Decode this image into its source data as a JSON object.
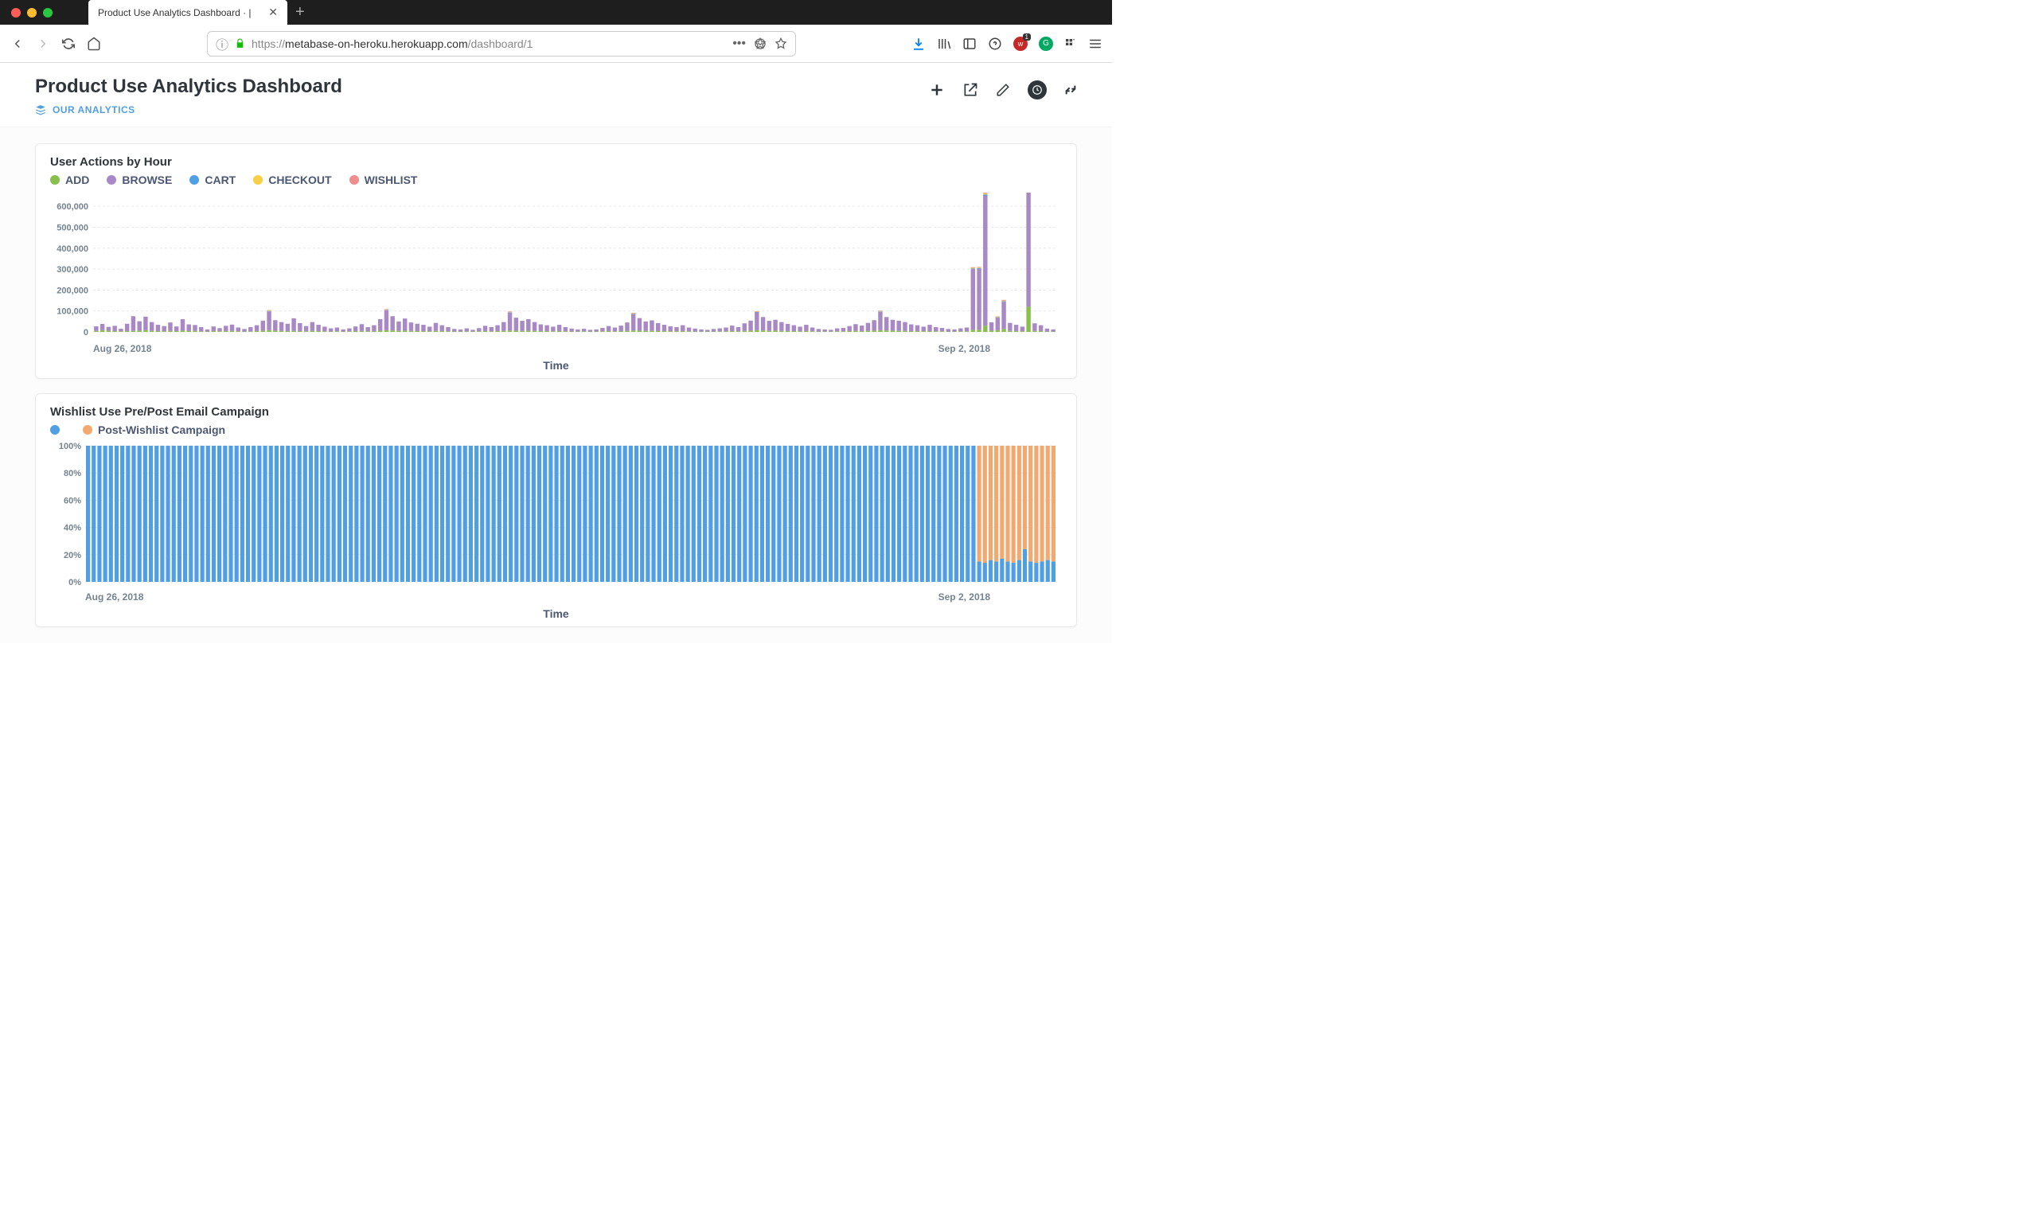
{
  "browser": {
    "tab_title": "Product Use Analytics Dashboard · |",
    "url_prefix": "https://",
    "url_host": "metabase-on-heroku.herokuapp.com",
    "url_path": "/dashboard/1"
  },
  "page": {
    "title": "Product Use Analytics Dashboard",
    "breadcrumb": "OUR ANALYTICS"
  },
  "chart1": {
    "title": "User Actions by Hour",
    "legend": [
      {
        "label": "ADD",
        "color": "#88BF4D"
      },
      {
        "label": "BROWSE",
        "color": "#A989C5"
      },
      {
        "label": "CART",
        "color": "#509EE3"
      },
      {
        "label": "CHECKOUT",
        "color": "#F9CF48"
      },
      {
        "label": "WISHLIST",
        "color": "#EF8C8C"
      }
    ],
    "ylabel_ticks": [
      "600,000",
      "500,000",
      "400,000",
      "300,000",
      "200,000",
      "100,000",
      "0"
    ],
    "xlabel": "Time",
    "xticks": [
      "Aug 26, 2018",
      "Sep 2, 2018"
    ]
  },
  "chart2": {
    "title": "Wishlist Use Pre/Post Email Campaign",
    "legend": [
      {
        "label": "",
        "color": "#509EE3"
      },
      {
        "label": "Post-Wishlist Campaign",
        "color": "#F2A86F"
      }
    ],
    "ylabel_ticks": [
      "100%",
      "80%",
      "60%",
      "40%",
      "20%",
      "0%"
    ],
    "xlabel": "Time",
    "xticks": [
      "Aug 26, 2018",
      "Sep 2, 2018"
    ]
  },
  "chart_data": [
    {
      "type": "bar",
      "title": "User Actions by Hour",
      "xlabel": "Time",
      "ylabel": "",
      "ylim": [
        0,
        650000
      ],
      "yticks": [
        0,
        100000,
        200000,
        300000,
        400000,
        500000,
        600000
      ],
      "categories_note": "hourly buckets from Aug 26 2018 through Sep 2 2018 (~170 bars)",
      "series": [
        {
          "name": "ADD",
          "color": "#88BF4D",
          "typical_range": [
            0,
            120000
          ]
        },
        {
          "name": "BROWSE",
          "color": "#A989C5",
          "typical_range": [
            5000,
            90000
          ],
          "spikes": [
            290000,
            290000,
            620000,
            130000,
            560000
          ]
        },
        {
          "name": "CART",
          "color": "#509EE3",
          "typical_range": [
            0,
            8000
          ]
        },
        {
          "name": "CHECKOUT",
          "color": "#F9CF48",
          "typical_range": [
            0,
            8000
          ]
        },
        {
          "name": "WISHLIST",
          "color": "#EF8C8C",
          "typical_range": [
            0,
            8000
          ]
        }
      ],
      "values": [
        [
          5,
          22,
          0,
          0,
          0
        ],
        [
          8,
          30,
          0,
          0,
          0
        ],
        [
          6,
          18,
          0,
          0,
          0
        ],
        [
          4,
          25,
          0,
          0,
          0
        ],
        [
          3,
          12,
          0,
          0,
          0
        ],
        [
          4,
          35,
          0,
          0,
          0
        ],
        [
          5,
          70,
          1,
          1,
          1
        ],
        [
          6,
          45,
          1,
          1,
          1
        ],
        [
          8,
          65,
          1,
          1,
          1
        ],
        [
          5,
          42,
          1,
          1,
          1
        ],
        [
          4,
          30,
          1,
          1,
          1
        ],
        [
          3,
          25,
          0,
          0,
          0
        ],
        [
          5,
          40,
          1,
          1,
          1
        ],
        [
          4,
          22,
          0,
          0,
          0
        ],
        [
          6,
          55,
          1,
          1,
          1
        ],
        [
          4,
          32,
          1,
          1,
          1
        ],
        [
          5,
          28,
          0,
          0,
          0
        ],
        [
          3,
          20,
          0,
          0,
          0
        ],
        [
          2,
          10,
          0,
          0,
          0
        ],
        [
          4,
          22,
          0,
          0,
          0
        ],
        [
          3,
          15,
          0,
          0,
          0
        ],
        [
          4,
          25,
          0,
          0,
          0
        ],
        [
          5,
          30,
          1,
          1,
          1
        ],
        [
          3,
          18,
          0,
          0,
          0
        ],
        [
          2,
          12,
          0,
          0,
          0
        ],
        [
          3,
          20,
          0,
          0,
          0
        ],
        [
          4,
          28,
          0,
          0,
          0
        ],
        [
          6,
          48,
          1,
          1,
          1
        ],
        [
          8,
          90,
          2,
          2,
          2
        ],
        [
          6,
          50,
          1,
          1,
          1
        ],
        [
          5,
          42,
          1,
          1,
          1
        ],
        [
          4,
          35,
          1,
          1,
          1
        ],
        [
          5,
          60,
          1,
          1,
          1
        ],
        [
          4,
          38,
          1,
          1,
          1
        ],
        [
          3,
          25,
          0,
          0,
          0
        ],
        [
          5,
          42,
          1,
          1,
          1
        ],
        [
          4,
          30,
          0,
          0,
          0
        ],
        [
          3,
          22,
          0,
          0,
          0
        ],
        [
          2,
          15,
          0,
          0,
          0
        ],
        [
          3,
          18,
          0,
          0,
          0
        ],
        [
          2,
          10,
          0,
          0,
          0
        ],
        [
          3,
          14,
          0,
          0,
          0
        ],
        [
          4,
          22,
          0,
          0,
          0
        ],
        [
          5,
          32,
          1,
          1,
          1
        ],
        [
          3,
          20,
          0,
          0,
          0
        ],
        [
          4,
          28,
          0,
          0,
          0
        ],
        [
          6,
          55,
          1,
          1,
          1
        ],
        [
          8,
          95,
          2,
          2,
          2
        ],
        [
          7,
          68,
          1,
          1,
          1
        ],
        [
          5,
          45,
          1,
          1,
          1
        ],
        [
          6,
          58,
          1,
          1,
          1
        ],
        [
          5,
          40,
          1,
          1,
          1
        ],
        [
          4,
          35,
          1,
          1,
          1
        ],
        [
          4,
          30,
          0,
          0,
          0
        ],
        [
          3,
          22,
          0,
          0,
          0
        ],
        [
          5,
          38,
          1,
          1,
          1
        ],
        [
          4,
          28,
          0,
          0,
          0
        ],
        [
          3,
          20,
          0,
          0,
          0
        ],
        [
          2,
          12,
          0,
          0,
          0
        ],
        [
          2,
          10,
          0,
          0,
          0
        ],
        [
          3,
          14,
          0,
          0,
          0
        ],
        [
          2,
          8,
          0,
          0,
          0
        ],
        [
          3,
          15,
          0,
          0,
          0
        ],
        [
          4,
          25,
          0,
          0,
          0
        ],
        [
          3,
          20,
          0,
          0,
          0
        ],
        [
          4,
          28,
          0,
          0,
          0
        ],
        [
          5,
          42,
          1,
          1,
          1
        ],
        [
          7,
          85,
          2,
          2,
          2
        ],
        [
          6,
          62,
          1,
          1,
          1
        ],
        [
          5,
          48,
          1,
          1,
          1
        ],
        [
          6,
          55,
          1,
          1,
          1
        ],
        [
          5,
          42,
          1,
          1,
          1
        ],
        [
          4,
          32,
          1,
          1,
          1
        ],
        [
          4,
          28,
          0,
          0,
          0
        ],
        [
          3,
          22,
          0,
          0,
          0
        ],
        [
          4,
          30,
          0,
          0,
          0
        ],
        [
          3,
          20,
          0,
          0,
          0
        ],
        [
          2,
          14,
          0,
          0,
          0
        ],
        [
          2,
          10,
          0,
          0,
          0
        ],
        [
          3,
          12,
          0,
          0,
          0
        ],
        [
          2,
          8,
          0,
          0,
          0
        ],
        [
          2,
          10,
          0,
          0,
          0
        ],
        [
          3,
          16,
          0,
          0,
          0
        ],
        [
          4,
          24,
          0,
          0,
          0
        ],
        [
          3,
          18,
          0,
          0,
          0
        ],
        [
          4,
          26,
          0,
          0,
          0
        ],
        [
          5,
          40,
          1,
          1,
          1
        ],
        [
          7,
          78,
          2,
          2,
          2
        ],
        [
          6,
          60,
          1,
          1,
          1
        ],
        [
          5,
          45,
          1,
          1,
          1
        ],
        [
          5,
          50,
          1,
          1,
          1
        ],
        [
          4,
          38,
          1,
          1,
          1
        ],
        [
          4,
          30,
          0,
          0,
          0
        ],
        [
          3,
          24,
          0,
          0,
          0
        ],
        [
          3,
          20,
          0,
          0,
          0
        ],
        [
          4,
          28,
          0,
          0,
          0
        ],
        [
          3,
          18,
          0,
          0,
          0
        ],
        [
          2,
          14,
          0,
          0,
          0
        ],
        [
          2,
          10,
          0,
          0,
          0
        ],
        [
          2,
          8,
          0,
          0,
          0
        ],
        [
          2,
          12,
          0,
          0,
          0
        ],
        [
          3,
          14,
          0,
          0,
          0
        ],
        [
          3,
          18,
          0,
          0,
          0
        ],
        [
          4,
          26,
          0,
          0,
          0
        ],
        [
          3,
          20,
          0,
          0,
          0
        ],
        [
          5,
          36,
          1,
          1,
          1
        ],
        [
          6,
          48,
          1,
          1,
          1
        ],
        [
          8,
          85,
          2,
          2,
          2
        ],
        [
          7,
          64,
          1,
          1,
          1
        ],
        [
          5,
          48,
          1,
          1,
          1
        ],
        [
          6,
          52,
          1,
          1,
          1
        ],
        [
          5,
          42,
          1,
          1,
          1
        ],
        [
          4,
          34,
          1,
          1,
          1
        ],
        [
          4,
          28,
          0,
          0,
          0
        ],
        [
          3,
          22,
          0,
          0,
          0
        ],
        [
          4,
          30,
          0,
          0,
          0
        ],
        [
          3,
          18,
          0,
          0,
          0
        ],
        [
          2,
          12,
          0,
          0,
          0
        ],
        [
          2,
          10,
          0,
          0,
          0
        ],
        [
          2,
          8,
          0,
          0,
          0
        ],
        [
          3,
          14,
          0,
          0,
          0
        ],
        [
          3,
          16,
          0,
          0,
          0
        ],
        [
          4,
          24,
          0,
          0,
          0
        ],
        [
          5,
          32,
          1,
          1,
          1
        ],
        [
          4,
          26,
          0,
          0,
          0
        ],
        [
          5,
          38,
          1,
          1,
          1
        ],
        [
          6,
          50,
          1,
          1,
          1
        ],
        [
          8,
          88,
          2,
          2,
          2
        ],
        [
          7,
          64,
          1,
          1,
          1
        ],
        [
          6,
          52,
          1,
          1,
          1
        ],
        [
          5,
          48,
          1,
          1,
          1
        ],
        [
          5,
          42,
          1,
          1,
          1
        ],
        [
          4,
          32,
          1,
          1,
          1
        ],
        [
          4,
          28,
          0,
          0,
          0
        ],
        [
          3,
          22,
          0,
          0,
          0
        ],
        [
          4,
          30,
          0,
          0,
          0
        ],
        [
          3,
          20,
          0,
          0,
          0
        ],
        [
          3,
          16,
          0,
          0,
          0
        ],
        [
          2,
          12,
          0,
          0,
          0
        ],
        [
          2,
          10,
          0,
          0,
          0
        ],
        [
          3,
          14,
          0,
          0,
          0
        ],
        [
          3,
          18,
          0,
          0,
          0
        ],
        [
          10,
          290,
          3,
          3,
          3
        ],
        [
          11,
          290,
          3,
          3,
          3
        ],
        [
          30,
          620,
          6,
          6,
          6
        ],
        [
          6,
          40,
          1,
          1,
          1
        ],
        [
          8,
          60,
          2,
          2,
          2
        ],
        [
          14,
          130,
          3,
          3,
          3
        ],
        [
          5,
          38,
          1,
          1,
          1
        ],
        [
          4,
          30,
          0,
          0,
          0
        ],
        [
          3,
          22,
          0,
          0,
          0
        ],
        [
          120,
          560,
          6,
          6,
          6
        ],
        [
          5,
          36,
          1,
          1,
          1
        ],
        [
          4,
          28,
          0,
          0,
          0
        ],
        [
          2,
          14,
          0,
          0,
          0
        ],
        [
          2,
          10,
          0,
          0,
          0
        ]
      ],
      "values_unit": "thousands"
    },
    {
      "type": "bar",
      "title": "Wishlist Use Pre/Post Email Campaign",
      "xlabel": "Time",
      "ylabel": "",
      "ylim": [
        0,
        100
      ],
      "yticks": [
        0,
        20,
        40,
        60,
        80,
        100
      ],
      "categories_note": "hourly buckets Aug 26 – Sep 2 2018 (~170 bars)",
      "series": [
        {
          "name": "",
          "color": "#509EE3"
        },
        {
          "name": "Post-Wishlist Campaign",
          "color": "#F2A86F"
        }
      ],
      "values_note": "each bar totals 100%; before Sep 2 the first series is 100/0, after campaign roughly 15/85",
      "values": {
        "pre_campaign_bars": 156,
        "pre_campaign_split": [
          100,
          0
        ],
        "post_campaign_splits": [
          [
            15,
            85
          ],
          [
            14,
            86
          ],
          [
            16,
            84
          ],
          [
            15,
            85
          ],
          [
            17,
            83
          ],
          [
            15,
            85
          ],
          [
            14,
            86
          ],
          [
            16,
            84
          ],
          [
            24,
            76
          ],
          [
            15,
            85
          ],
          [
            14,
            86
          ],
          [
            15,
            85
          ],
          [
            16,
            84
          ],
          [
            15,
            85
          ]
        ]
      }
    }
  ]
}
